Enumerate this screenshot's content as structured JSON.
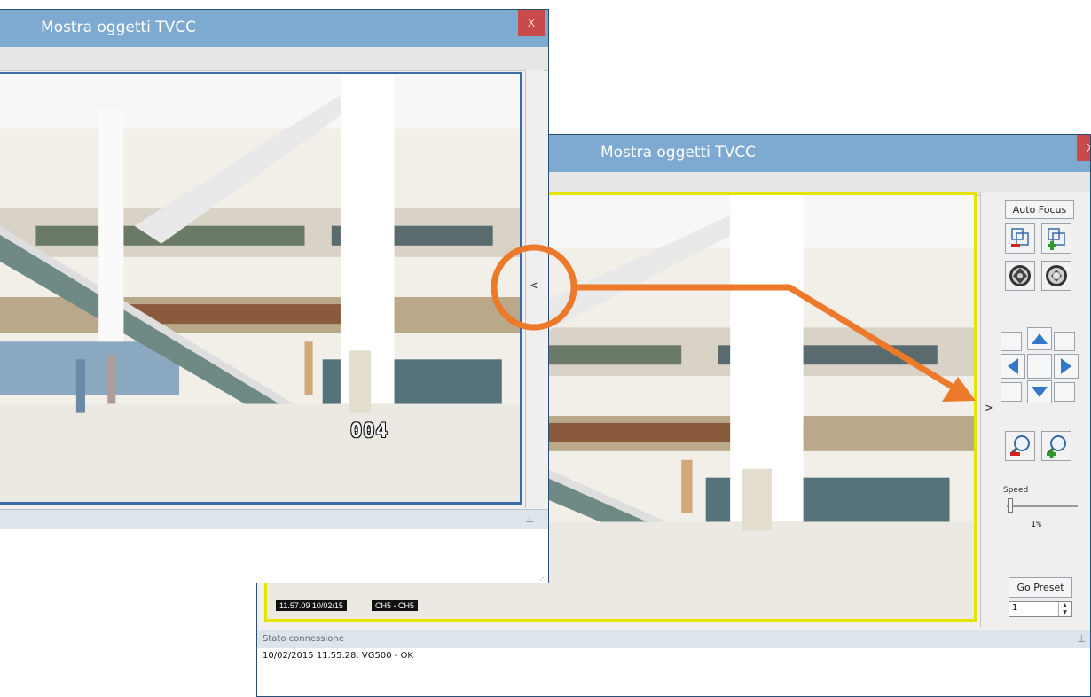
{
  "window_front": {
    "title": "Mostra oggetti TVCC",
    "close_label": "X",
    "camera_number": "004",
    "collapse_glyph": "<"
  },
  "window_back": {
    "title": "Mostra oggetti TVCC",
    "close_label": "X",
    "expand_glyph": ">",
    "osd_time": "11.57.09 10/02/15",
    "osd_channel": "CH5 - CH5",
    "status_panel_title": "Stato connessione",
    "log_line": "10/02/2015 11.55.28: VG500 - OK"
  },
  "ptz_panel": {
    "auto_focus_label": "Auto Focus",
    "icons": [
      "focus-out-icon",
      "focus-in-icon",
      "iris-close-icon",
      "iris-open-icon",
      "arrow-up-icon",
      "arrow-left-icon",
      "arrow-right-icon",
      "arrow-down-icon",
      "zoom-out-icon",
      "zoom-in-icon"
    ],
    "speed_label": "Speed",
    "speed_value": "1%",
    "speed_fraction": 0.01,
    "go_preset_label": "Go Preset",
    "preset_value": "1"
  },
  "colors": {
    "titlebar": "#7ea9d1",
    "close": "#c94a4a",
    "callout": "#ec7a2a",
    "video_frame_front": "#3a6aa8",
    "video_frame_back": "#e4e400"
  }
}
